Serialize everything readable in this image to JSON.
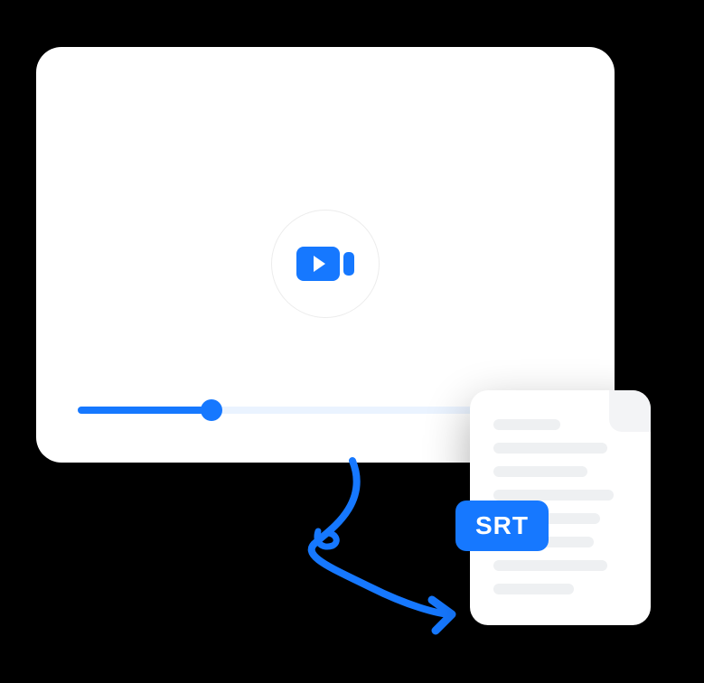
{
  "colors": {
    "accent": "#1678ff",
    "background": "#000000",
    "card": "#ffffff",
    "track": "#eaf3ff",
    "fileLine": "#eef0f2"
  },
  "video": {
    "progress_percent": 27
  },
  "file": {
    "badge_label": "SRT",
    "line_widths": [
      "50%",
      "85%",
      "70%",
      "90%",
      "80%",
      "75%",
      "85%",
      "60%"
    ]
  },
  "icons": {
    "play": "video-camera-play",
    "arrow": "curved-arrow"
  }
}
